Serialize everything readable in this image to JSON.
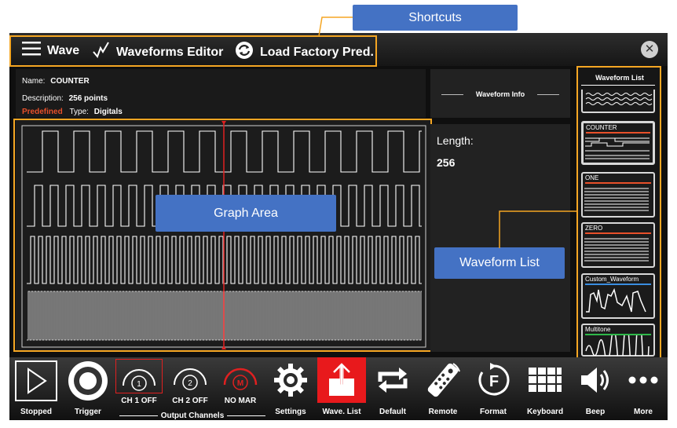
{
  "callouts": {
    "shortcuts": "Shortcuts",
    "graph_area": "Graph Area",
    "waveform_list": "Waveform List"
  },
  "topbar": {
    "wave": "Wave",
    "editor": "Waveforms Editor",
    "factory": "Load Factory Pred."
  },
  "info": {
    "name_label": "Name:",
    "name_value": "COUNTER",
    "desc_label": "Description:",
    "desc_value": "256 points",
    "predefined": "Predefined",
    "type_label": "Type:",
    "type_value": "Digitals"
  },
  "waveform_info": {
    "title": "Waveform Info",
    "length_label": "Length:",
    "length_value": "256"
  },
  "waveform_list": {
    "title": "Waveform List",
    "items": [
      {
        "name": "COUNTER",
        "color": "#e8502a"
      },
      {
        "name": "ONE",
        "color": "#e8502a"
      },
      {
        "name": "ZERO",
        "color": "#e8502a"
      },
      {
        "name": "Custom_Waveform",
        "color": "#3a8de0"
      },
      {
        "name": "Multitone",
        "color": "#2fb84a"
      }
    ]
  },
  "bottombar": {
    "stopped": "Stopped",
    "trigger": "Trigger",
    "ch1": "CH 1 OFF",
    "ch1_num": "1",
    "ch2": "CH 2 OFF",
    "ch2_num": "2",
    "nomar": "NO MAR",
    "nomar_letter": "M",
    "output_channels": "Output Channels",
    "settings": "Settings",
    "wave_list": "Wave. List",
    "default": "Default",
    "remote": "Remote",
    "format": "Format",
    "format_letter": "F",
    "keyboard": "Keyboard",
    "beep": "Beep",
    "more": "More"
  },
  "colors": {
    "accent_orange": "#f5a623",
    "callout_blue": "#4472c4",
    "predefined_red": "#e8502a",
    "cursor_red": "#e02020"
  }
}
